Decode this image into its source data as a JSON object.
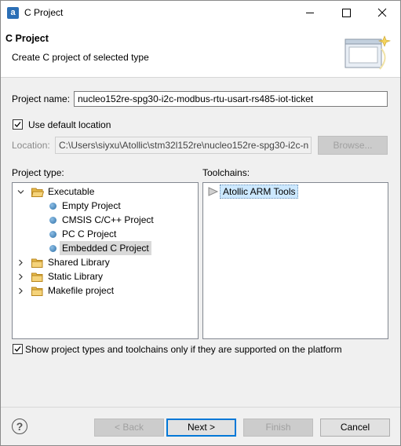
{
  "window": {
    "title": "C Project",
    "app_icon_glyph": "a",
    "controls": {
      "minimize": "minimize-icon",
      "maximize": "maximize-icon",
      "close": "close-icon"
    }
  },
  "header": {
    "title": "C Project",
    "description": "Create C project of selected type"
  },
  "form": {
    "project_name_label": "Project name:",
    "project_name_value": "nucleo152re-spg30-i2c-modbus-rtu-usart-rs485-iot-ticket",
    "use_default_location_label": "Use default location",
    "use_default_location_checked": true,
    "location_label": "Location:",
    "location_value": "C:\\Users\\siyxu\\Atollic\\stm32l152re\\nucleo152re-spg30-i2c-n",
    "browse_label": "Browse..."
  },
  "project_type": {
    "label": "Project type:",
    "items": [
      {
        "label": "Executable",
        "kind": "folder",
        "expanded": true
      },
      {
        "label": "Empty Project",
        "kind": "leaf"
      },
      {
        "label": "CMSIS C/C++ Project",
        "kind": "leaf"
      },
      {
        "label": "PC C Project",
        "kind": "leaf"
      },
      {
        "label": "Embedded C Project",
        "kind": "leaf",
        "selected": true
      },
      {
        "label": "Shared Library",
        "kind": "folder",
        "expanded": false
      },
      {
        "label": "Static Library",
        "kind": "folder",
        "expanded": false
      },
      {
        "label": "Makefile project",
        "kind": "folder",
        "expanded": false
      }
    ]
  },
  "toolchains": {
    "label": "Toolchains:",
    "items": [
      {
        "label": "Atollic ARM Tools",
        "selected": true
      }
    ]
  },
  "filter": {
    "label": "Show project types and toolchains only if they are supported on the platform",
    "checked": true
  },
  "buttons": {
    "back": "< Back",
    "next": "Next >",
    "finish": "Finish",
    "cancel": "Cancel",
    "help_glyph": "?"
  },
  "colors": {
    "accent": "#0078d7",
    "selection": "#d9d9d9",
    "toolchain_selection": "#cce8ff"
  }
}
